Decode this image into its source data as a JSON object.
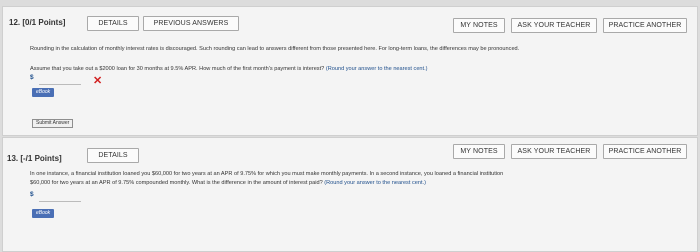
{
  "q12": {
    "number_label": "12.  [0/1 Points]",
    "buttons": {
      "details": "DETAILS",
      "previous_answers": "PREVIOUS ANSWERS",
      "my_notes": "MY NOTES",
      "ask_teacher": "ASK YOUR TEACHER",
      "practice_another": "PRACTICE ANOTHER"
    },
    "note_text": "Rounding in the calculation of monthly interest rates is discouraged. Such rounding can lead to answers different from those presented here. For long-term loans, the differences may be pronounced.",
    "question_text": "Assume that you take out a $2000 loan for 30 months at 9.5% APR. How much of the first month's payment is interest?",
    "hint_text": "(Round your answer to the nearest cent.)",
    "currency": "$",
    "answer_value": "",
    "result_icon": "x-mark-icon",
    "ebook_label": "eBook",
    "submit_label": "Submit Answer"
  },
  "q13": {
    "number_label": "13.  [-/1 Points]",
    "buttons": {
      "details": "DETAILS",
      "my_notes": "MY NOTES",
      "ask_teacher": "ASK YOUR TEACHER",
      "practice_another": "PRACTICE ANOTHER"
    },
    "question_line1": "In one instance, a financial institution loaned you $60,000 for two years at an APR of 9.75% for which you must make monthly payments. In a second instance, you loaned a financial institution",
    "question_line2": "$60,000 for two years at an APR of 9.75% compounded monthly. What is the difference in the amount of interest paid?",
    "hint_text": "(Round your answer to the nearest cent.)",
    "currency": "$",
    "answer_value": "",
    "ebook_label": "eBook"
  },
  "colors": {
    "panel_bg": "#f4f4f4",
    "page_bg": "#dcdcdc",
    "error": "#d21f1f",
    "ebook_bg": "#4a6fb5",
    "answer_text": "#1f4f8c"
  }
}
